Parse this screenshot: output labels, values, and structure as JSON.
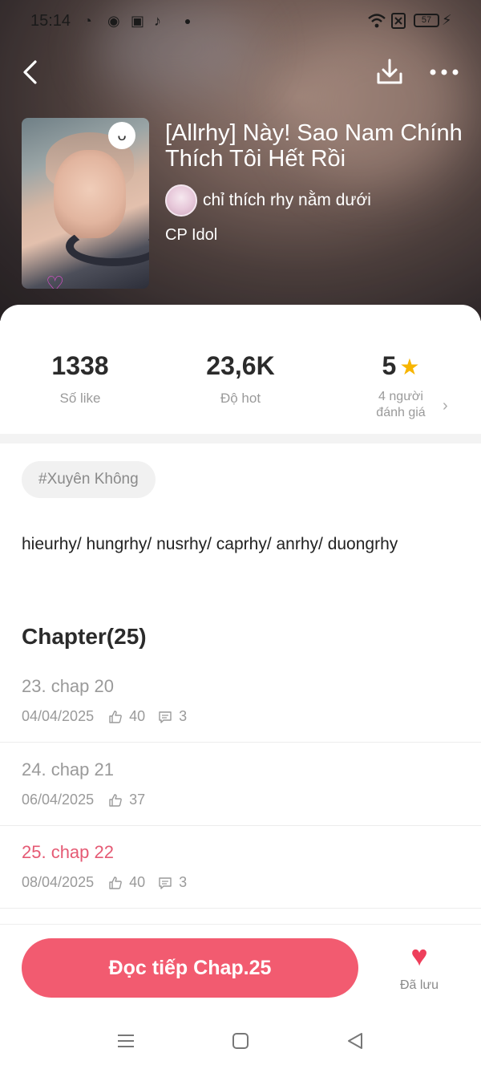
{
  "status_bar": {
    "time": "15:14",
    "battery": "57"
  },
  "story": {
    "title": "[Allrhy] Này! Sao Nam Chính Thích Tôi Hết Rồi",
    "author": "chỉ thích rhy nằm dưới",
    "genre": "CP Idol"
  },
  "stats": {
    "likes": {
      "value": "1338",
      "label": "Số like"
    },
    "hot": {
      "value": "23,6K",
      "label": "Độ hot"
    },
    "rating": {
      "value": "5",
      "label_line1": "4 người",
      "label_line2": "đánh giá"
    }
  },
  "tag": "#Xuyên Không",
  "description": "hieurhy/ hungrhy/ nusrhy/ caprhy/ anrhy/ duongrhy",
  "chapters_header": "Chapter(25)",
  "chapters": [
    {
      "name": "23. chap 20",
      "date": "04/04/2025",
      "likes": "40",
      "comments": "3"
    },
    {
      "name": "24. chap 21",
      "date": "06/04/2025",
      "likes": "37"
    },
    {
      "name": "25. chap 22",
      "date": "08/04/2025",
      "likes": "40",
      "comments": "3"
    }
  ],
  "actions": {
    "read_label": "Đọc tiếp Chap.25",
    "saved_label": "Đã lưu"
  },
  "icons": [
    "back-arrow-icon",
    "download-icon",
    "more-icon",
    "star-icon",
    "like-icon",
    "comment-icon",
    "heart-icon",
    "menu-icon",
    "home-icon",
    "back-icon"
  ],
  "colors": {
    "accent": "#f25b70",
    "active_chapter": "#e55a74",
    "star": "#f7b500",
    "heart": "#ee3f5b"
  }
}
